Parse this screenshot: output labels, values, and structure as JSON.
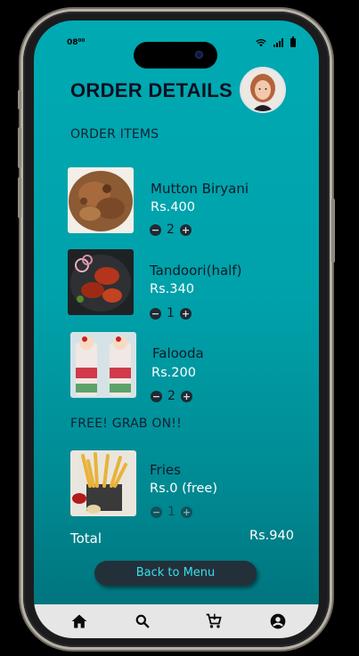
{
  "status_bar": {
    "time": "08⁰⁰"
  },
  "header": {
    "title": "ORDER DETAILS"
  },
  "order_items": {
    "heading": "ORDER ITEMS",
    "items": [
      {
        "name": "Mutton Biryani",
        "price": "Rs.400",
        "qty": "2"
      },
      {
        "name": "Tandoori(half)",
        "price": "Rs.340",
        "qty": "1"
      },
      {
        "name": "Falooda",
        "price": "Rs.200",
        "qty": "2"
      }
    ]
  },
  "free_section": {
    "heading": "FREE! GRAB ON!!",
    "item": {
      "name": "Fries",
      "price": "Rs.0 (free)",
      "qty": "1"
    }
  },
  "summary": {
    "total_label": "Total",
    "total_value": "Rs.940"
  },
  "actions": {
    "back_label": "Back to Menu"
  },
  "bottom_nav": {
    "items": [
      {
        "icon": "home-icon"
      },
      {
        "icon": "search-icon"
      },
      {
        "icon": "cart-icon"
      },
      {
        "icon": "account-icon"
      }
    ]
  },
  "colors": {
    "accent": "#00a9b2",
    "button_bg": "#23303a",
    "button_text": "#38e0ea"
  }
}
